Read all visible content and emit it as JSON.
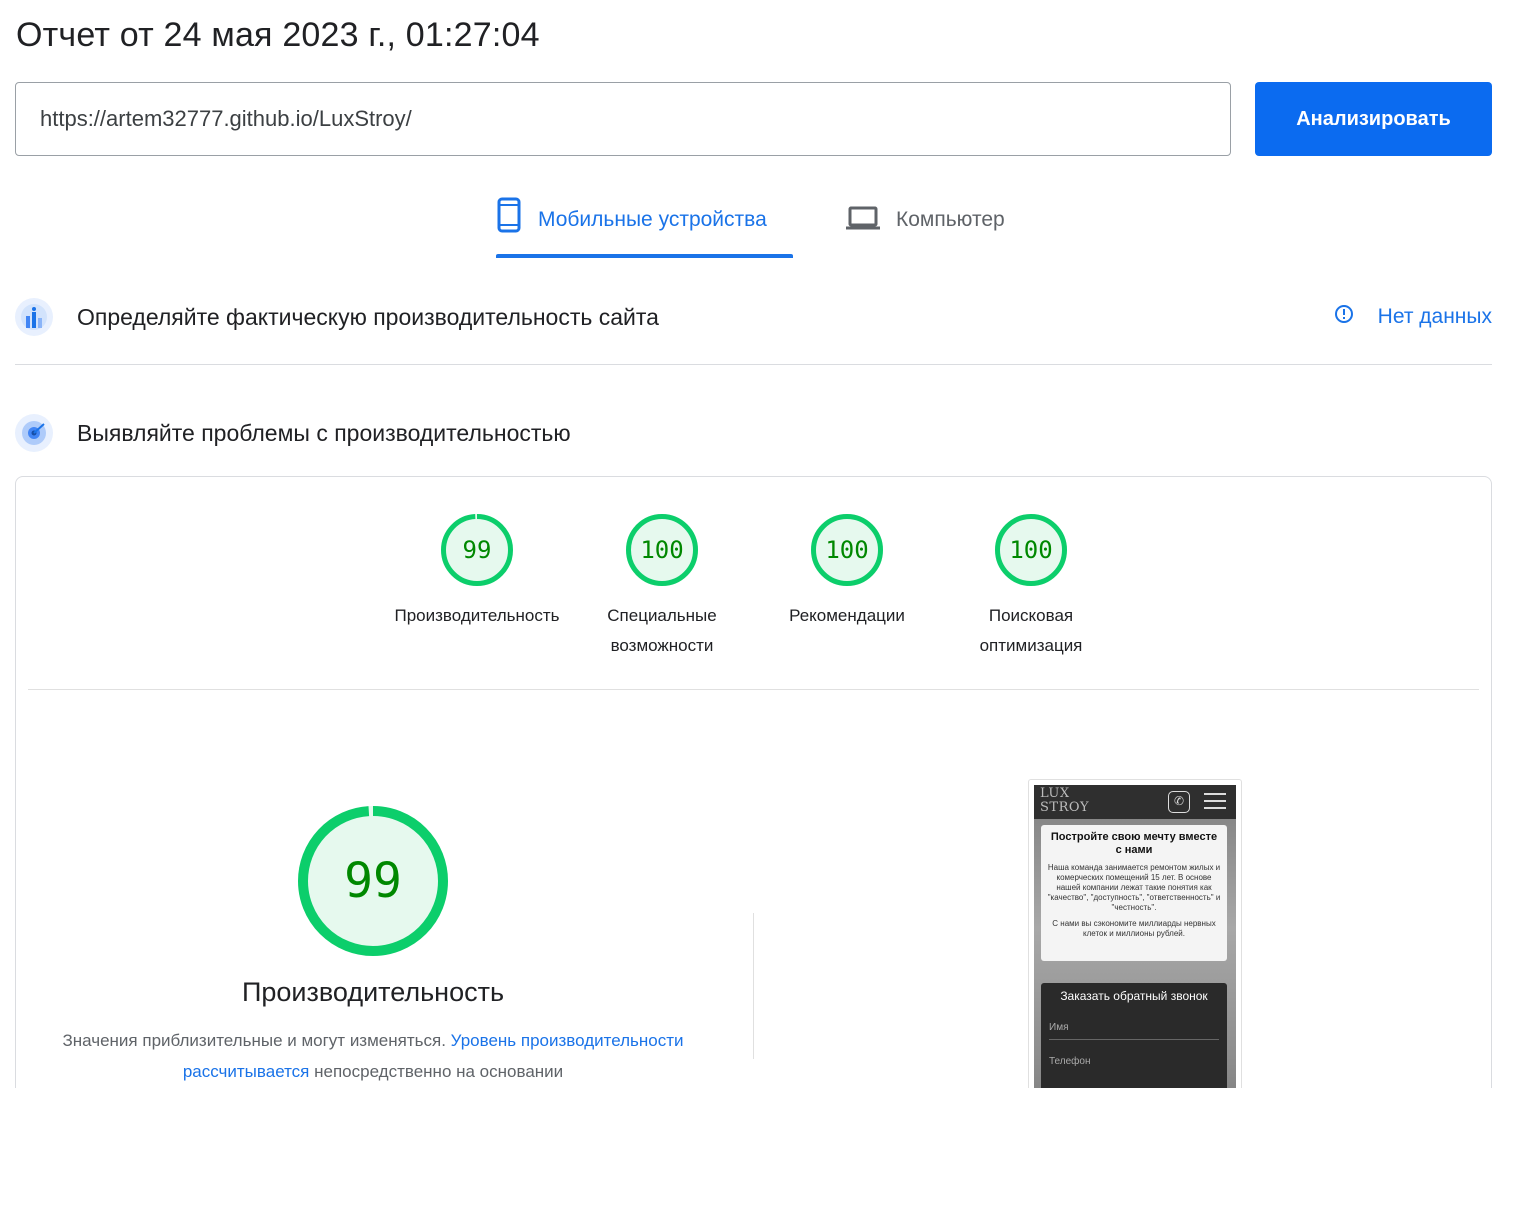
{
  "report": {
    "title": "Отчет от 24 мая 2023 г., 01:27:04"
  },
  "search": {
    "url": "https://artem32777.github.io/LuxStroy/",
    "analyze_label": "Анализировать"
  },
  "tabs": [
    {
      "label": "Мобильные устройства",
      "icon": "smartphone-icon",
      "active": true
    },
    {
      "label": "Компьютер",
      "icon": "laptop-icon",
      "active": false
    }
  ],
  "field_section": {
    "title": "Определяйте фактическую производительность сайта",
    "status": "Нет данных",
    "icon": "field-data-icon"
  },
  "lab_section": {
    "title": "Выявляйте проблемы с производительностью",
    "icon": "lab-data-icon"
  },
  "scores": [
    {
      "value": "99",
      "label": "Производительность",
      "fraction": 0.99
    },
    {
      "value": "100",
      "label_line1": "Специальные",
      "label_line2": "возможности",
      "fraction": 1.0
    },
    {
      "value": "100",
      "label": "Рекомендации",
      "fraction": 1.0
    },
    {
      "value": "100",
      "label_line1": "Поисковая",
      "label_line2": "оптимизация",
      "fraction": 1.0
    }
  ],
  "performance": {
    "score": "99",
    "fraction": 0.99,
    "title": "Производительность",
    "desc_start": "Значения приблизительные и могут изменяться.",
    "desc_link": "Уровень производительности рассчитывается",
    "desc_end": "непосредственно на основании"
  },
  "preview": {
    "logo_line1": "LUX",
    "logo_line2": "STROY",
    "hero_title": "Постройте свою мечту вместе с нами",
    "hero_text1": "Наша команда занимается ремонтом жилых и комерческих помещений 15 лет. В основе нашей компании лежат такие понятия как \"качество\", \"доступность\", \"ответственность\" и \"честность\".",
    "hero_text2": "С нами вы сэкономите миллиарды нервных клеток и миллионы рублей.",
    "form_title": "Заказать обратный звонок",
    "field_name": "Имя",
    "field_phone": "Телефон"
  },
  "colors": {
    "accent": "#1a73e8",
    "button": "#0b6bf0",
    "pass": "#0cce6b",
    "pass_fill": "#e6f9ee",
    "pass_text": "#008800"
  }
}
